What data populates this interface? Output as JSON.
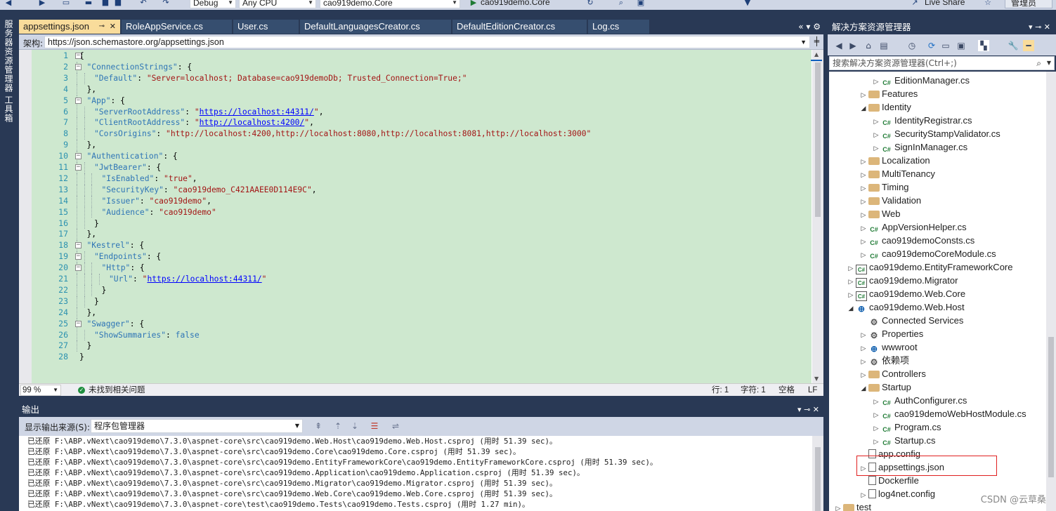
{
  "toolbar": {
    "config": "Debug",
    "platform": "Any CPU",
    "startup_project": "cao919demo.Core",
    "run_target": "cao919demo.Core",
    "live_share": "Live Share",
    "admin": "管理员"
  },
  "left_strip": {
    "server_explorer": "服务器资源管理器",
    "toolbox": "工具箱"
  },
  "tabs": [
    {
      "label": "appsettings.json",
      "active": true
    },
    {
      "label": "RoleAppService.cs"
    },
    {
      "label": "User.cs"
    },
    {
      "label": "DefaultLanguagesCreator.cs"
    },
    {
      "label": "DefaultEditionCreator.cs"
    },
    {
      "label": "Log.cs"
    }
  ],
  "schema": {
    "label": "架构:",
    "value": "https://json.schemastore.org/appsettings.json"
  },
  "editor": {
    "line_numbers": [
      "1",
      "2",
      "3",
      "4",
      "5",
      "6",
      "7",
      "8",
      "9",
      "10",
      "11",
      "12",
      "13",
      "14",
      "15",
      "16",
      "17",
      "18",
      "19",
      "20",
      "21",
      "22",
      "23",
      "24",
      "25",
      "26",
      "27",
      "28"
    ],
    "code_lines": [
      {
        "ind": 0,
        "parts": [
          {
            "c": "p",
            "t": "{"
          }
        ]
      },
      {
        "ind": 1,
        "parts": [
          {
            "c": "k",
            "t": "\"ConnectionStrings\""
          },
          {
            "c": "p",
            "t": ": {"
          }
        ]
      },
      {
        "ind": 2,
        "parts": [
          {
            "c": "k",
            "t": "\"Default\""
          },
          {
            "c": "p",
            "t": ": "
          },
          {
            "c": "s",
            "t": "\"Server=localhost; Database=cao919demoDb; Trusted_Connection=True;\""
          }
        ]
      },
      {
        "ind": 1,
        "parts": [
          {
            "c": "p",
            "t": "},"
          }
        ]
      },
      {
        "ind": 1,
        "parts": [
          {
            "c": "k",
            "t": "\"App\""
          },
          {
            "c": "p",
            "t": ": {"
          }
        ]
      },
      {
        "ind": 2,
        "parts": [
          {
            "c": "k",
            "t": "\"ServerRootAddress\""
          },
          {
            "c": "p",
            "t": ": "
          },
          {
            "c": "s",
            "t": "\""
          },
          {
            "c": "u",
            "t": "https://localhost:44311/"
          },
          {
            "c": "s",
            "t": "\""
          },
          {
            "c": "p",
            "t": ","
          }
        ]
      },
      {
        "ind": 2,
        "parts": [
          {
            "c": "k",
            "t": "\"ClientRootAddress\""
          },
          {
            "c": "p",
            "t": ": "
          },
          {
            "c": "s",
            "t": "\""
          },
          {
            "c": "u",
            "t": "http://localhost:4200/"
          },
          {
            "c": "s",
            "t": "\""
          },
          {
            "c": "p",
            "t": ","
          }
        ]
      },
      {
        "ind": 2,
        "parts": [
          {
            "c": "k",
            "t": "\"CorsOrigins\""
          },
          {
            "c": "p",
            "t": ": "
          },
          {
            "c": "s",
            "t": "\"http://localhost:4200,http://localhost:8080,http://localhost:8081,http://localhost:3000\""
          }
        ]
      },
      {
        "ind": 1,
        "parts": [
          {
            "c": "p",
            "t": "},"
          }
        ]
      },
      {
        "ind": 1,
        "parts": [
          {
            "c": "k",
            "t": "\"Authentication\""
          },
          {
            "c": "p",
            "t": ": {"
          }
        ]
      },
      {
        "ind": 2,
        "parts": [
          {
            "c": "k",
            "t": "\"JwtBearer\""
          },
          {
            "c": "p",
            "t": ": {"
          }
        ]
      },
      {
        "ind": 3,
        "parts": [
          {
            "c": "k",
            "t": "\"IsEnabled\""
          },
          {
            "c": "p",
            "t": ": "
          },
          {
            "c": "s",
            "t": "\"true\""
          },
          {
            "c": "p",
            "t": ","
          }
        ]
      },
      {
        "ind": 3,
        "parts": [
          {
            "c": "k",
            "t": "\"SecurityKey\""
          },
          {
            "c": "p",
            "t": ": "
          },
          {
            "c": "s",
            "t": "\"cao919demo_C421AAEE0D114E9C\""
          },
          {
            "c": "p",
            "t": ","
          }
        ]
      },
      {
        "ind": 3,
        "parts": [
          {
            "c": "k",
            "t": "\"Issuer\""
          },
          {
            "c": "p",
            "t": ": "
          },
          {
            "c": "s",
            "t": "\"cao919demo\""
          },
          {
            "c": "p",
            "t": ","
          }
        ]
      },
      {
        "ind": 3,
        "parts": [
          {
            "c": "k",
            "t": "\"Audience\""
          },
          {
            "c": "p",
            "t": ": "
          },
          {
            "c": "s",
            "t": "\"cao919demo\""
          }
        ]
      },
      {
        "ind": 2,
        "parts": [
          {
            "c": "p",
            "t": "}"
          }
        ]
      },
      {
        "ind": 1,
        "parts": [
          {
            "c": "p",
            "t": "},"
          }
        ]
      },
      {
        "ind": 1,
        "parts": [
          {
            "c": "k",
            "t": "\"Kestrel\""
          },
          {
            "c": "p",
            "t": ": {"
          }
        ]
      },
      {
        "ind": 2,
        "parts": [
          {
            "c": "k",
            "t": "\"Endpoints\""
          },
          {
            "c": "p",
            "t": ": {"
          }
        ]
      },
      {
        "ind": 3,
        "parts": [
          {
            "c": "k",
            "t": "\"Http\""
          },
          {
            "c": "p",
            "t": ": {"
          }
        ]
      },
      {
        "ind": 4,
        "parts": [
          {
            "c": "k",
            "t": "\"Url\""
          },
          {
            "c": "p",
            "t": ": "
          },
          {
            "c": "s",
            "t": "\""
          },
          {
            "c": "u",
            "t": "https://localhost:44311/"
          },
          {
            "c": "s",
            "t": "\""
          }
        ]
      },
      {
        "ind": 3,
        "parts": [
          {
            "c": "p",
            "t": "}"
          }
        ]
      },
      {
        "ind": 2,
        "parts": [
          {
            "c": "p",
            "t": "}"
          }
        ]
      },
      {
        "ind": 1,
        "parts": [
          {
            "c": "p",
            "t": "},"
          }
        ]
      },
      {
        "ind": 1,
        "parts": [
          {
            "c": "k",
            "t": "\"Swagger\""
          },
          {
            "c": "p",
            "t": ": {"
          }
        ]
      },
      {
        "ind": 2,
        "parts": [
          {
            "c": "k",
            "t": "\"ShowSummaries\""
          },
          {
            "c": "p",
            "t": ": "
          },
          {
            "c": "k",
            "t": "false"
          }
        ]
      },
      {
        "ind": 1,
        "parts": [
          {
            "c": "p",
            "t": "}"
          }
        ]
      },
      {
        "ind": 0,
        "parts": [
          {
            "c": "p",
            "t": "}"
          }
        ]
      }
    ],
    "fold_lines": [
      1,
      2,
      5,
      10,
      11,
      18,
      19,
      20,
      25
    ]
  },
  "status": {
    "zoom": "99 %",
    "issues": "未找到相关问题",
    "line": "行: 1",
    "col": "字符: 1",
    "spaces": "空格",
    "eol": "LF"
  },
  "output": {
    "title": "输出",
    "source_label": "显示输出来源(S):",
    "source_value": "程序包管理器",
    "lines": [
      "已还原 F:\\ABP.vNext\\cao919demo\\7.3.0\\aspnet-core\\src\\cao919demo.Web.Host\\cao919demo.Web.Host.csproj (用时 51.39 sec)。",
      "已还原 F:\\ABP.vNext\\cao919demo\\7.3.0\\aspnet-core\\src\\cao919demo.Core\\cao919demo.Core.csproj (用时 51.39 sec)。",
      "已还原 F:\\ABP.vNext\\cao919demo\\7.3.0\\aspnet-core\\src\\cao919demo.EntityFrameworkCore\\cao919demo.EntityFrameworkCore.csproj (用时 51.39 sec)。",
      "已还原 F:\\ABP.vNext\\cao919demo\\7.3.0\\aspnet-core\\src\\cao919demo.Application\\cao919demo.Application.csproj (用时 51.39 sec)。",
      "已还原 F:\\ABP.vNext\\cao919demo\\7.3.0\\aspnet-core\\src\\cao919demo.Migrator\\cao919demo.Migrator.csproj (用时 51.39 sec)。",
      "已还原 F:\\ABP.vNext\\cao919demo\\7.3.0\\aspnet-core\\src\\cao919demo.Web.Core\\cao919demo.Web.Core.csproj (用时 51.39 sec)。",
      "已还原 F:\\ABP.vNext\\cao919demo\\7.3.0\\aspnet-core\\test\\cao919demo.Tests\\cao919demo.Tests.csproj (用时 1.27 min)。"
    ]
  },
  "solution_explorer": {
    "title": "解决方案资源管理器",
    "search_placeholder": "搜索解决方案资源管理器(Ctrl+;)",
    "nodes": [
      {
        "label": "EditionManager.cs",
        "depth": 3,
        "icon": "cs",
        "exp": "closed"
      },
      {
        "label": "Features",
        "depth": 2,
        "icon": "folder",
        "exp": "closed"
      },
      {
        "label": "Identity",
        "depth": 2,
        "icon": "folder",
        "exp": "open"
      },
      {
        "label": "IdentityRegistrar.cs",
        "depth": 3,
        "icon": "cs",
        "exp": "closed"
      },
      {
        "label": "SecurityStampValidator.cs",
        "depth": 3,
        "icon": "cs",
        "exp": "closed"
      },
      {
        "label": "SignInManager.cs",
        "depth": 3,
        "icon": "cs",
        "exp": "closed"
      },
      {
        "label": "Localization",
        "depth": 2,
        "icon": "folder",
        "exp": "closed"
      },
      {
        "label": "MultiTenancy",
        "depth": 2,
        "icon": "folder",
        "exp": "closed"
      },
      {
        "label": "Timing",
        "depth": 2,
        "icon": "folder",
        "exp": "closed"
      },
      {
        "label": "Validation",
        "depth": 2,
        "icon": "folder",
        "exp": "closed"
      },
      {
        "label": "Web",
        "depth": 2,
        "icon": "folder",
        "exp": "closed"
      },
      {
        "label": "AppVersionHelper.cs",
        "depth": 2,
        "icon": "cs",
        "exp": "closed"
      },
      {
        "label": "cao919demoConsts.cs",
        "depth": 2,
        "icon": "cs",
        "exp": "closed"
      },
      {
        "label": "cao919demoCoreModule.cs",
        "depth": 2,
        "icon": "cs",
        "exp": "closed"
      },
      {
        "label": "cao919demo.EntityFrameworkCore",
        "depth": 1,
        "icon": "proj",
        "exp": "closed"
      },
      {
        "label": "cao919demo.Migrator",
        "depth": 1,
        "icon": "proj",
        "exp": "closed"
      },
      {
        "label": "cao919demo.Web.Core",
        "depth": 1,
        "icon": "proj",
        "exp": "closed"
      },
      {
        "label": "cao919demo.Web.Host",
        "depth": 1,
        "icon": "web",
        "exp": "open"
      },
      {
        "label": "Connected Services",
        "depth": 2,
        "icon": "gear",
        "exp": "none"
      },
      {
        "label": "Properties",
        "depth": 2,
        "icon": "gear",
        "exp": "closed"
      },
      {
        "label": "wwwroot",
        "depth": 2,
        "icon": "web",
        "exp": "closed"
      },
      {
        "label": "依赖项",
        "depth": 2,
        "icon": "gear",
        "exp": "closed"
      },
      {
        "label": "Controllers",
        "depth": 2,
        "icon": "folder",
        "exp": "closed"
      },
      {
        "label": "Startup",
        "depth": 2,
        "icon": "folder",
        "exp": "open"
      },
      {
        "label": "AuthConfigurer.cs",
        "depth": 3,
        "icon": "cs",
        "exp": "closed"
      },
      {
        "label": "cao919demoWebHostModule.cs",
        "depth": 3,
        "icon": "cs",
        "exp": "closed"
      },
      {
        "label": "Program.cs",
        "depth": 3,
        "icon": "cs",
        "exp": "closed"
      },
      {
        "label": "Startup.cs",
        "depth": 3,
        "icon": "cs",
        "exp": "closed"
      },
      {
        "label": "app.config",
        "depth": 2,
        "icon": "file",
        "exp": "none"
      },
      {
        "label": "appsettings.json",
        "depth": 2,
        "icon": "file",
        "exp": "closed",
        "selected": true
      },
      {
        "label": "Dockerfile",
        "depth": 2,
        "icon": "file",
        "exp": "none"
      },
      {
        "label": "log4net.config",
        "depth": 2,
        "icon": "file",
        "exp": "closed"
      },
      {
        "label": "test",
        "depth": 0,
        "icon": "folder",
        "exp": "closed"
      }
    ]
  },
  "watermark": "CSDN @云草桑",
  "colors": {
    "chrome": "#293955",
    "code_bg": "#cee8cf",
    "key": "#2e75b6",
    "string": "#a31515",
    "link": "#0000ff",
    "highlight_box": "#e02020"
  }
}
